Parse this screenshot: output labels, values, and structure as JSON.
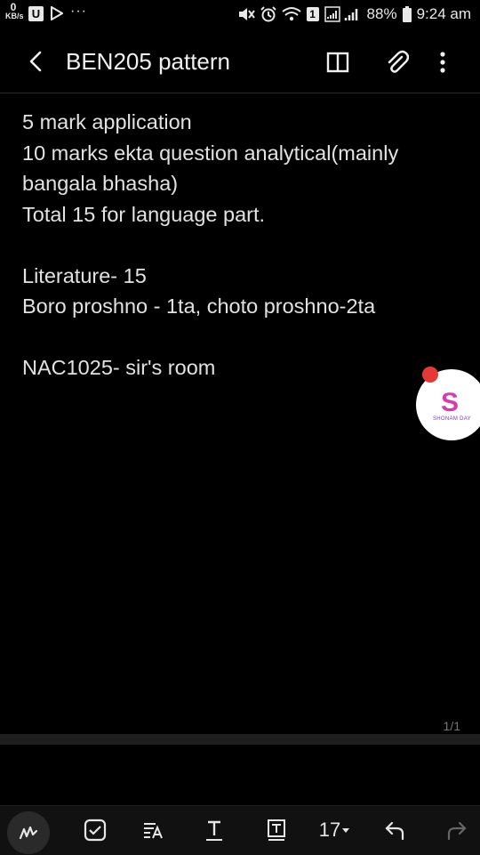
{
  "status_bar": {
    "speed_value": "0",
    "speed_unit": "KB/s",
    "u_badge": "U",
    "more": "···",
    "sim_label": "1",
    "battery": "88%",
    "time": "9:24 am",
    "icons": [
      "mute-icon",
      "alarm-icon",
      "wifi-icon",
      "sim-icon",
      "signal-icon",
      "battery-icon"
    ]
  },
  "toolbar": {
    "title": "BEN205 pattern",
    "icons": [
      "back-icon",
      "reading-mode-icon",
      "attach-icon",
      "more-options-icon"
    ]
  },
  "note": {
    "lines": [
      "5 mark application",
      "10 marks ekta question analytical(mainly",
      "bangala bhasha)",
      "Total 15 for language part.",
      "",
      "Literature- 15",
      "Boro proshno - 1ta, choto proshno-2ta",
      "",
      "NAC1025- sir's room"
    ]
  },
  "page_indicator": "1/1",
  "bubble": {
    "logo_letter": "S",
    "caption": "SHONAM DAY"
  },
  "bottom_toolbar": {
    "font_size": "17",
    "icons": [
      "handwriting-icon",
      "checkbox-icon",
      "paragraph-format-icon",
      "text-underline-icon",
      "text-box-icon",
      "dropdown-icon",
      "undo-icon",
      "redo-icon"
    ]
  },
  "colors": {
    "background": "#000000",
    "text": "#e2e2e2",
    "badge": "#e53935"
  }
}
